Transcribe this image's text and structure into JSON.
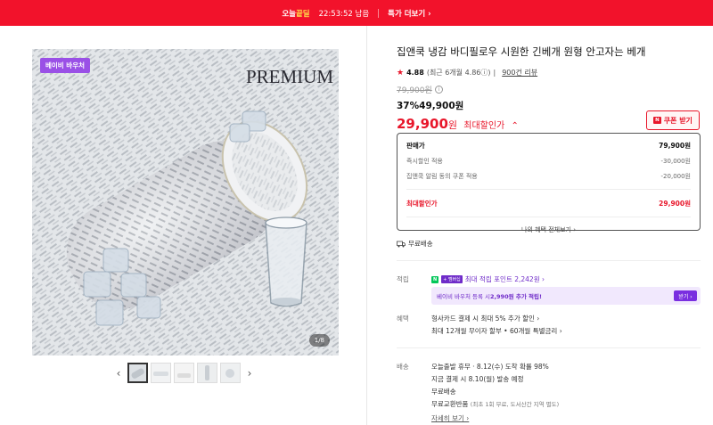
{
  "banner": {
    "brand_prefix": "오늘",
    "brand_suffix": "끝딜",
    "timer": "22:53:52",
    "timer_suffix": "남음",
    "more_link": "특가 더보기 ›",
    "bg_color": "#f2122b"
  },
  "gallery": {
    "badge": "베이비 바우처",
    "image_text": "PREMIUM",
    "counter": "1/8",
    "prev_arrow": "‹",
    "next_arrow": "›",
    "thumbnail_count": 5
  },
  "product": {
    "title": "집앤쿡 냉감 바디필로우 시원한 긴베개 원형 안고자는 베개",
    "rating": {
      "star": "★",
      "score": "4.88",
      "recent": "(최근 6개월 4.86ⓘ)",
      "sep": "|",
      "reviews": "900건 리뷰"
    },
    "original_price": "79,900원",
    "info_icon": "i",
    "discount_pct": "37%",
    "discount_price": "49,900원",
    "final_price": "29,900",
    "won": "원",
    "final_label": "최대할인가",
    "final_chevron": "⌃",
    "coupon_icon": "N",
    "coupon_btn": "쿠폰 받기"
  },
  "price_box": {
    "rows": [
      {
        "label": "판매가",
        "value": "79,900원"
      },
      {
        "label": "즉시할인 적용",
        "value": "-30,000원"
      },
      {
        "label": "집앤쿡 알림 동의 쿠폰 적용",
        "value": "-20,000원"
      }
    ],
    "max_label": "최대할인가",
    "max_value": "29,900원",
    "all_benefits": "나의 혜택 전체보기 ›"
  },
  "shipping_free": "무료배송",
  "points": {
    "label": "적립",
    "npay": "N",
    "plus": "+ 멤버십",
    "text": "최대 적립 포인트 2,242원 ›",
    "baby_prefix": "베이비 바우처 등록 시 ",
    "baby_bold": "2,990원 추가 적립!",
    "baby_btn": "받기 ›"
  },
  "benefits": {
    "label": "혜택",
    "line1": "형사카드 결제 시 최대 5% 추가 할인 ›",
    "line2": "최대 12개월 무이자 할부 • 60개월 특별금리 ›"
  },
  "delivery": {
    "label": "배송",
    "line1": "오늘출발 휴무 · 8.12(수) 도착 확률 98%",
    "line2": "지금 결제 시 8.10(월) 발송 예정",
    "line3": "무료배송",
    "line4_main": "무료교환반품 ",
    "line4_sub": "(최초 1회 무료, 도서산간 지역 별도)",
    "detail_link": "자세히 보기 ›"
  }
}
